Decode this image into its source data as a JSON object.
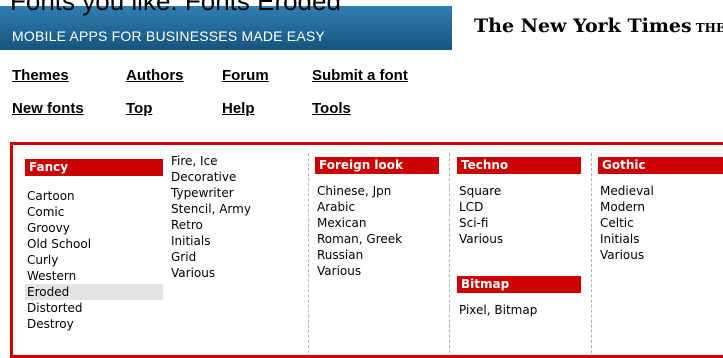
{
  "page": {
    "banner_title": "Fonts you like: Fonts Eroded"
  },
  "ads": {
    "left_tagline": "MOBILE APPS FOR BUSINESSES MADE EASY",
    "right_text": "The New York Times",
    "right_small": "THE"
  },
  "nav": {
    "themes": "Themes",
    "authors": "Authors",
    "forum": "Forum",
    "submit": "Submit a font",
    "new_fonts": "New fonts",
    "top": "Top",
    "help": "Help",
    "tools": "Tools"
  },
  "categories": {
    "fancy": {
      "header": "Fancy",
      "items": [
        "Cartoon",
        "Comic",
        "Groovy",
        "Old School",
        "Curly",
        "Western",
        "Eroded",
        "Distorted",
        "Destroy"
      ]
    },
    "fancy_more": {
      "items": [
        "Fire, Ice",
        "Decorative",
        "Typewriter",
        "Stencil, Army",
        "Retro",
        "Initials",
        "Grid",
        "Various"
      ]
    },
    "foreign": {
      "header": "Foreign look",
      "items": [
        "Chinese, Jpn",
        "Arabic",
        "Mexican",
        "Roman, Greek",
        "Russian",
        "Various"
      ]
    },
    "techno": {
      "header": "Techno",
      "items": [
        "Square",
        "LCD",
        "Sci-fi",
        "Various"
      ]
    },
    "bitmap": {
      "header": "Bitmap",
      "items": [
        "Pixel, Bitmap"
      ]
    },
    "gothic": {
      "header": "Gothic",
      "items": [
        "Medieval",
        "Modern",
        "Celtic",
        "Initials",
        "Various"
      ]
    }
  },
  "selected_item": "Eroded"
}
